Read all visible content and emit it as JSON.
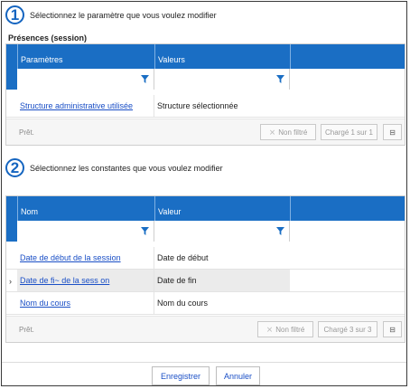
{
  "step1": {
    "number": "1",
    "text": "Sélectionnez le paramètre que vous voulez modifier"
  },
  "section_title": "Présences (session)",
  "grid1": {
    "columns": [
      "Paramètres",
      "Valeurs"
    ],
    "rows": [
      {
        "param": "Structure administrative utilisée",
        "value": "Structure sélectionnée"
      }
    ],
    "status": "Prêt.",
    "filter_button": "Non filtré",
    "load_button": "Chargé 1 sur 1"
  },
  "step2": {
    "number": "2",
    "text": "Sélectionnez les constantes que vous voulez modifier"
  },
  "grid2": {
    "columns": [
      "Nom",
      "Valeur"
    ],
    "rows": [
      {
        "name": "Date de début de la session",
        "value": "Date de début"
      },
      {
        "name": "Date de fi~ de la sess on",
        "value": "Date de fin"
      },
      {
        "name": "Nom du cours",
        "value": "Nom du cours"
      }
    ],
    "status": "Prêt.",
    "filter_button": "Non filtré",
    "load_button": "Chargé 3 sur 3"
  },
  "actions": {
    "save": "Enregistrer",
    "cancel": "Annuler"
  },
  "colors": {
    "header_blue": "#1a6ec4",
    "link_blue": "#1a4fc6",
    "step_blue": "#1565c0"
  },
  "icons": [
    "funnel-icon",
    "filter-clear-icon",
    "export-icon",
    "row-pointer-icon"
  ]
}
